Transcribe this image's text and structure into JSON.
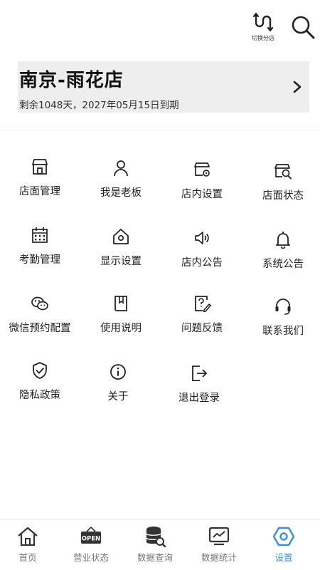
{
  "header": {
    "switch_store_label": "切换分店"
  },
  "store": {
    "name": "南京-雨花店",
    "expire_text": "剩余1048天，2027年05月15日到期"
  },
  "menu": {
    "items": [
      {
        "label": "店面管理",
        "icon": "storefront-icon"
      },
      {
        "label": "我是老板",
        "icon": "person-icon"
      },
      {
        "label": "店内设置",
        "icon": "store-settings-icon"
      },
      {
        "label": "店面状态",
        "icon": "store-search-icon"
      },
      {
        "label": "考勤管理",
        "icon": "calendar-icon"
      },
      {
        "label": "显示设置",
        "icon": "home-gear-icon"
      },
      {
        "label": "店内公告",
        "icon": "speaker-icon"
      },
      {
        "label": "系统公告",
        "icon": "bell-icon"
      },
      {
        "label": "微信预约配置",
        "icon": "wechat-icon"
      },
      {
        "label": "使用说明",
        "icon": "book-icon"
      },
      {
        "label": "问题反馈",
        "icon": "feedback-edit-icon"
      },
      {
        "label": "联系我们",
        "icon": "headset-icon"
      },
      {
        "label": "隐私政策",
        "icon": "shield-check-icon"
      },
      {
        "label": "关于",
        "icon": "info-icon"
      },
      {
        "label": "退出登录",
        "icon": "logout-icon"
      }
    ]
  },
  "tabbar": {
    "open_sign_text": "OPEN",
    "tabs": [
      {
        "label": "首页",
        "icon": "home-icon"
      },
      {
        "label": "营业状态",
        "icon": "open-sign-icon"
      },
      {
        "label": "数据查询",
        "icon": "database-search-icon"
      },
      {
        "label": "数据统计",
        "icon": "chart-icon"
      },
      {
        "label": "设置",
        "icon": "hexagon-settings-icon",
        "active": true
      }
    ],
    "active_color": "#3a8dde"
  }
}
